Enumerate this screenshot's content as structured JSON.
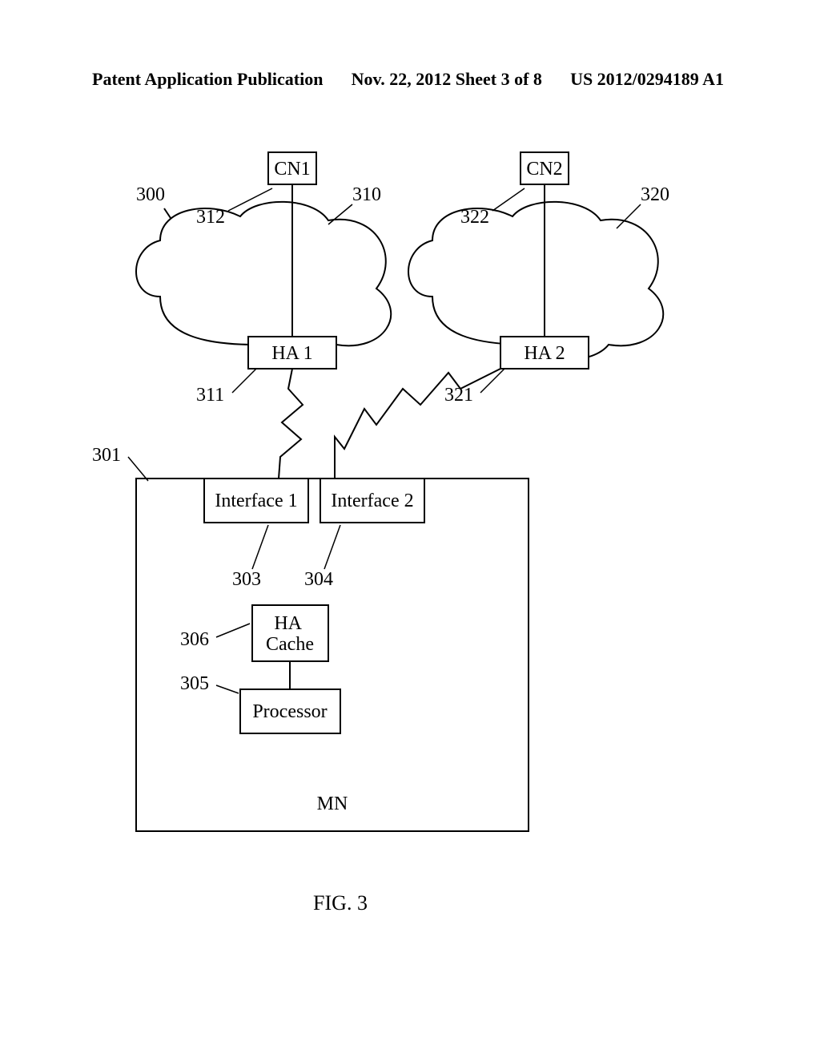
{
  "header": {
    "left": "Patent Application Publication",
    "center": "Nov. 22, 2012  Sheet 3 of 8",
    "right": "US 2012/0294189 A1"
  },
  "diagram": {
    "sysRef": "300",
    "cloud1": {
      "cn": "CN1",
      "cnRef": "312",
      "cloudRef": "310",
      "ha": "HA 1",
      "haRef": "311"
    },
    "cloud2": {
      "cn": "CN2",
      "cnRef": "322",
      "cloudRef": "320",
      "ha": "HA 2",
      "haRef": "321"
    },
    "mn": {
      "label": "MN",
      "ref": "301",
      "if1": {
        "label": "Interface 1",
        "ref": "303"
      },
      "if2": {
        "label": "Interface 2",
        "ref": "304"
      },
      "cache": {
        "label": "HA\nCache",
        "ref": "306"
      },
      "proc": {
        "label": "Processor",
        "ref": "305"
      }
    }
  },
  "caption": "FIG. 3"
}
